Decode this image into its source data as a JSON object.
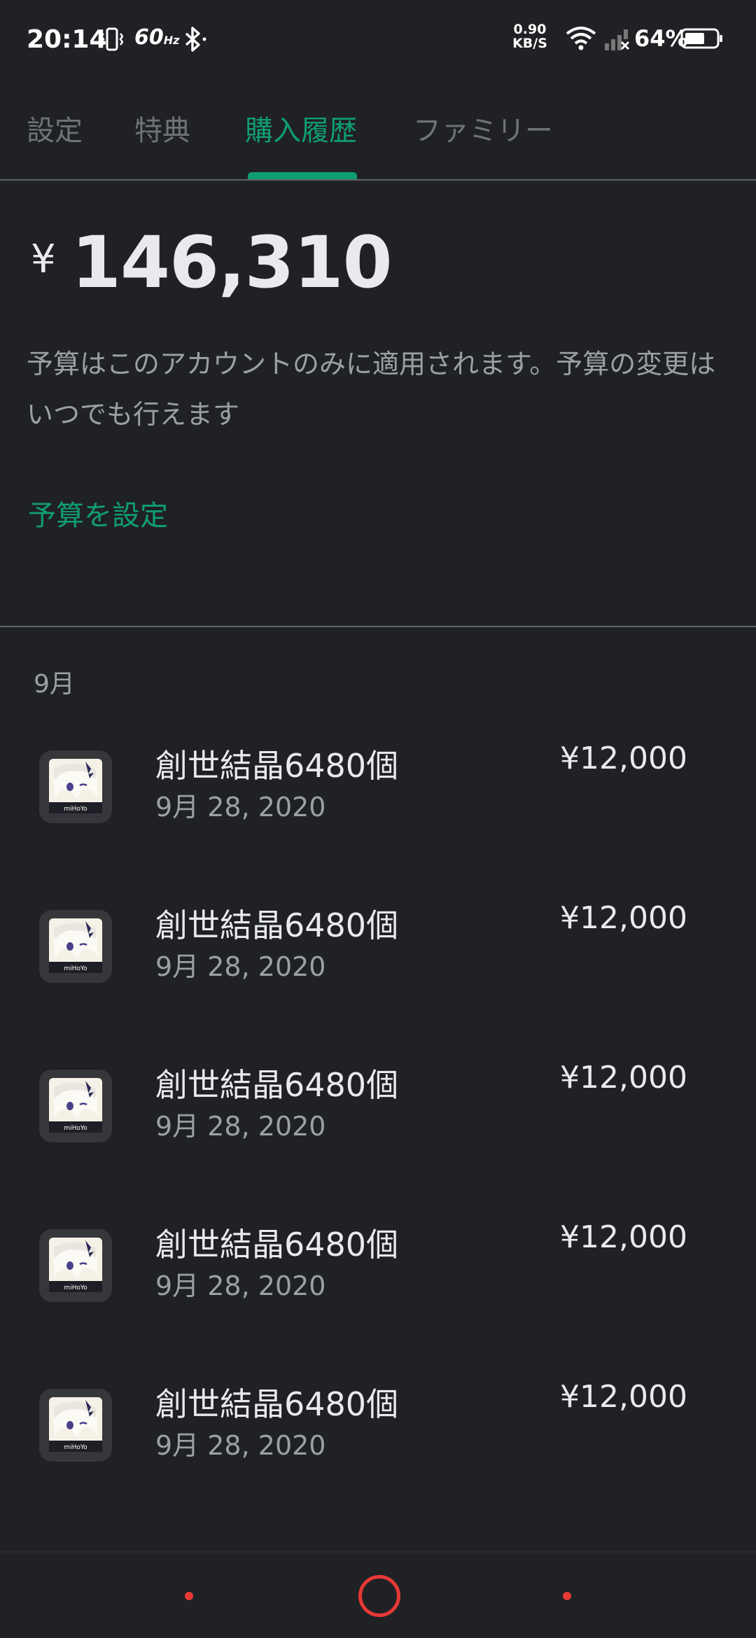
{
  "status_bar": {
    "time": "20:14",
    "refresh_rate": "60",
    "refresh_unit": "Hz",
    "net_speed_value": "0.90",
    "net_speed_unit": "KB/S",
    "battery_percent": "64%",
    "battery_level": 0.64
  },
  "tabs": [
    {
      "label": "設定"
    },
    {
      "label": "特典"
    },
    {
      "label": "購入履歴",
      "active": true
    },
    {
      "label": "ファミリー"
    }
  ],
  "budget": {
    "currency": "¥",
    "amount": "146,310",
    "description": "予算はこのアカウントのみに適用されます。予算の変更はいつでも行えます",
    "set_budget_label": "予算を設定"
  },
  "history": {
    "month": "9月",
    "items": [
      {
        "title": "創世結晶6480個",
        "date": "9月 28, 2020",
        "price": "¥12,000"
      },
      {
        "title": "創世結晶6480個",
        "date": "9月 28, 2020",
        "price": "¥12,000"
      },
      {
        "title": "創世結晶6480個",
        "date": "9月 28, 2020",
        "price": "¥12,000"
      },
      {
        "title": "創世結晶6480個",
        "date": "9月 28, 2020",
        "price": "¥12,000"
      },
      {
        "title": "創世結晶6480個",
        "date": "9月 28, 2020",
        "price": "¥12,000"
      }
    ]
  },
  "colors": {
    "background": "#202124",
    "accent": "#0f9d74",
    "nav_accent": "#e53935"
  }
}
